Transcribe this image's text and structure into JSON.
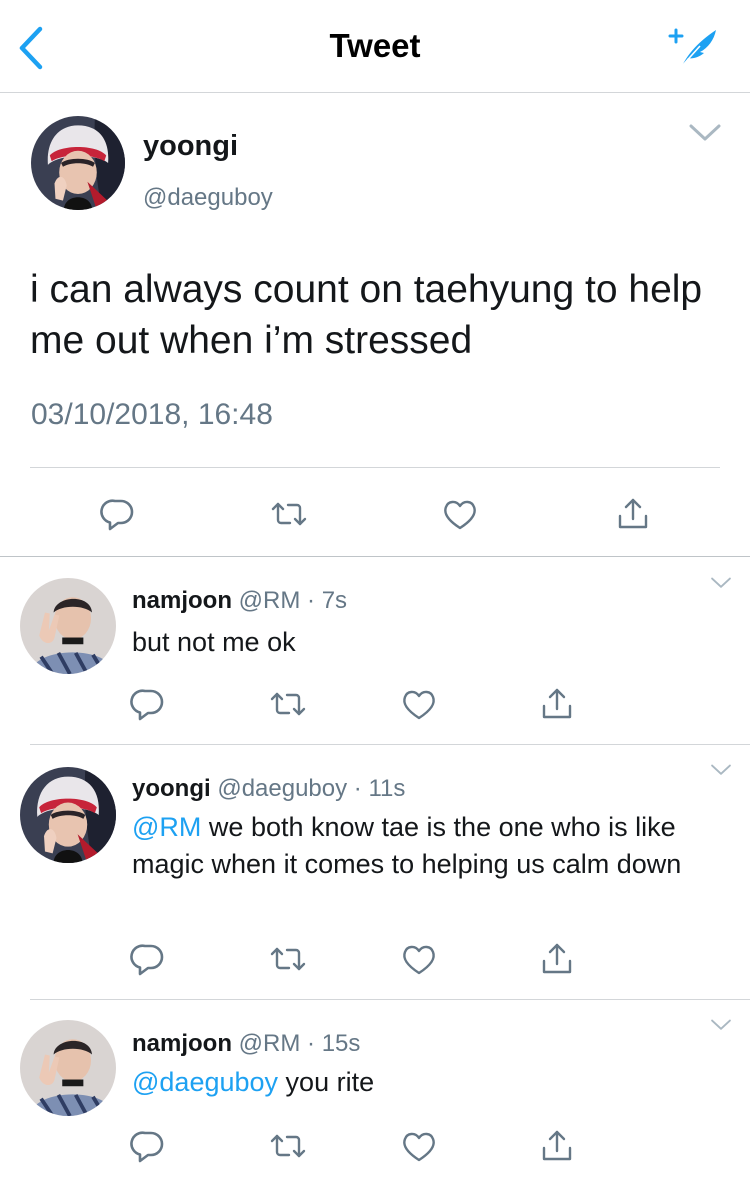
{
  "header": {
    "title": "Tweet",
    "back_icon": "chevron-left-icon",
    "compose_icon": "compose-tweet-icon",
    "accent_color": "#1da1f2"
  },
  "main_tweet": {
    "author_name": "yoongi",
    "author_handle": "@daeguboy",
    "text": "i can always count on taehyung to help me out when i’m stressed",
    "timestamp": "03/10/2018, 16:48",
    "actions": [
      "reply-icon",
      "retweet-icon",
      "like-icon",
      "share-icon"
    ]
  },
  "replies": [
    {
      "name": "namjoon",
      "handle": "@RM",
      "time": "7s",
      "mention": "",
      "text": "but not me ok"
    },
    {
      "name": "yoongi",
      "handle": "@daeguboy",
      "time": "11s",
      "mention": "@RM",
      "text": "we both know tae is the one who is like magic when it comes to helping us calm down"
    },
    {
      "name": "namjoon",
      "handle": "@RM",
      "time": "15s",
      "mention": "@daeguboy",
      "text": "you rite"
    }
  ],
  "colors": {
    "text_primary": "#14171a",
    "text_secondary": "#657786",
    "divider": "#d3d6d9",
    "link": "#1da1f2"
  }
}
